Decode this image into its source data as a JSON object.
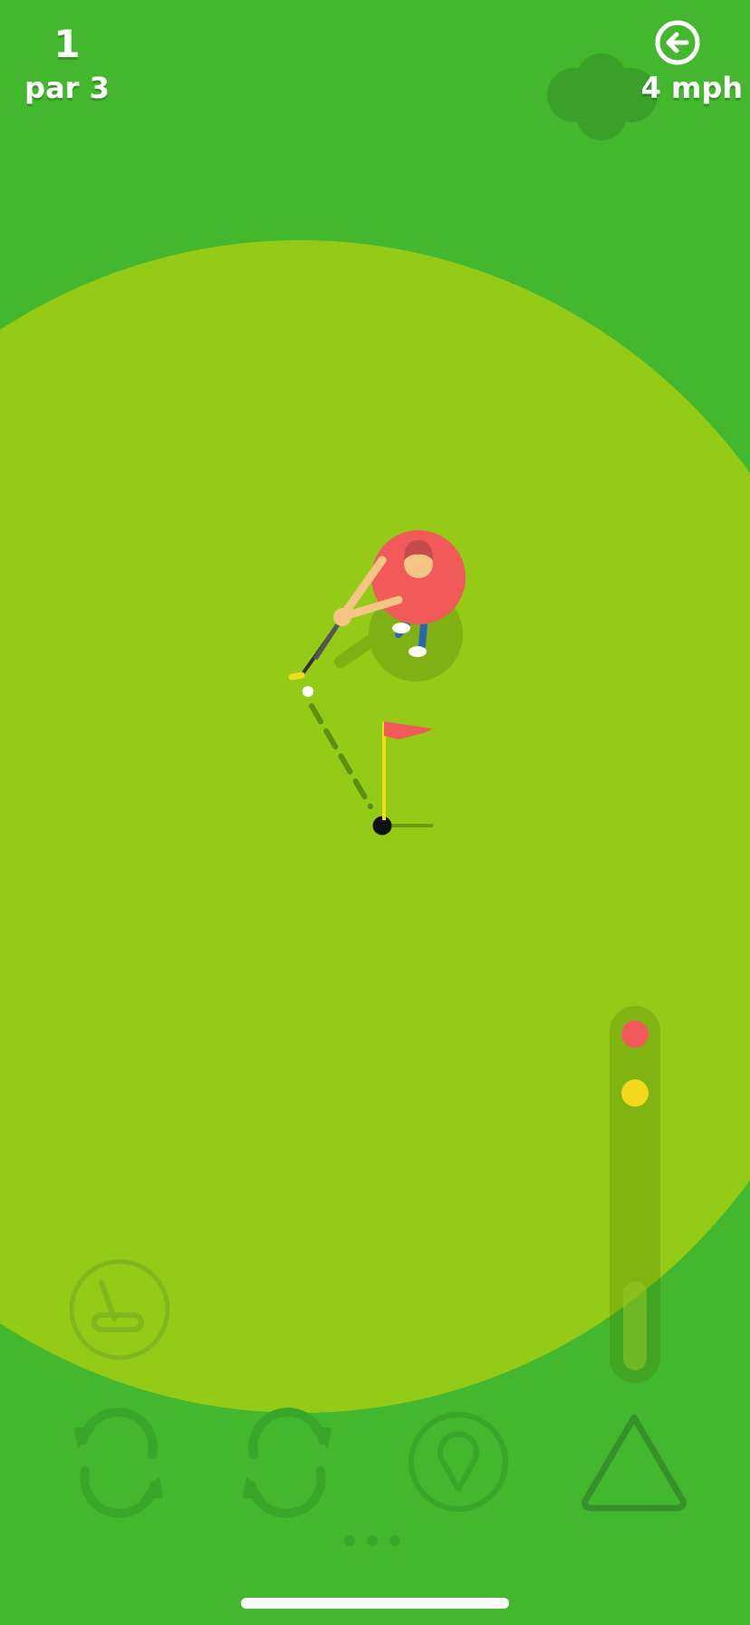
{
  "hud": {
    "hole_number": "1",
    "par_label": "par 3",
    "wind_speed": "4 mph",
    "wind_direction_icon": "arrow-left-circle-icon"
  },
  "controls": {
    "club_icon": "putter-icon",
    "rotate_left_icon": "rotate-counterclockwise-icon",
    "rotate_right_icon": "rotate-clockwise-icon",
    "aim_icon": "location-pin-icon",
    "swing_icon": "triangle-icon"
  },
  "power_meter": {
    "markers": [
      "red",
      "yellow"
    ],
    "fill_level": 0.25
  },
  "colors": {
    "rough": "#43b72d",
    "green": "#93cb16",
    "player_shirt": "#f25a5a",
    "flag": "#f25a5a",
    "pin": "#f4d81e",
    "meter_red": "#f25a5a",
    "meter_yellow": "#f4d81e"
  }
}
